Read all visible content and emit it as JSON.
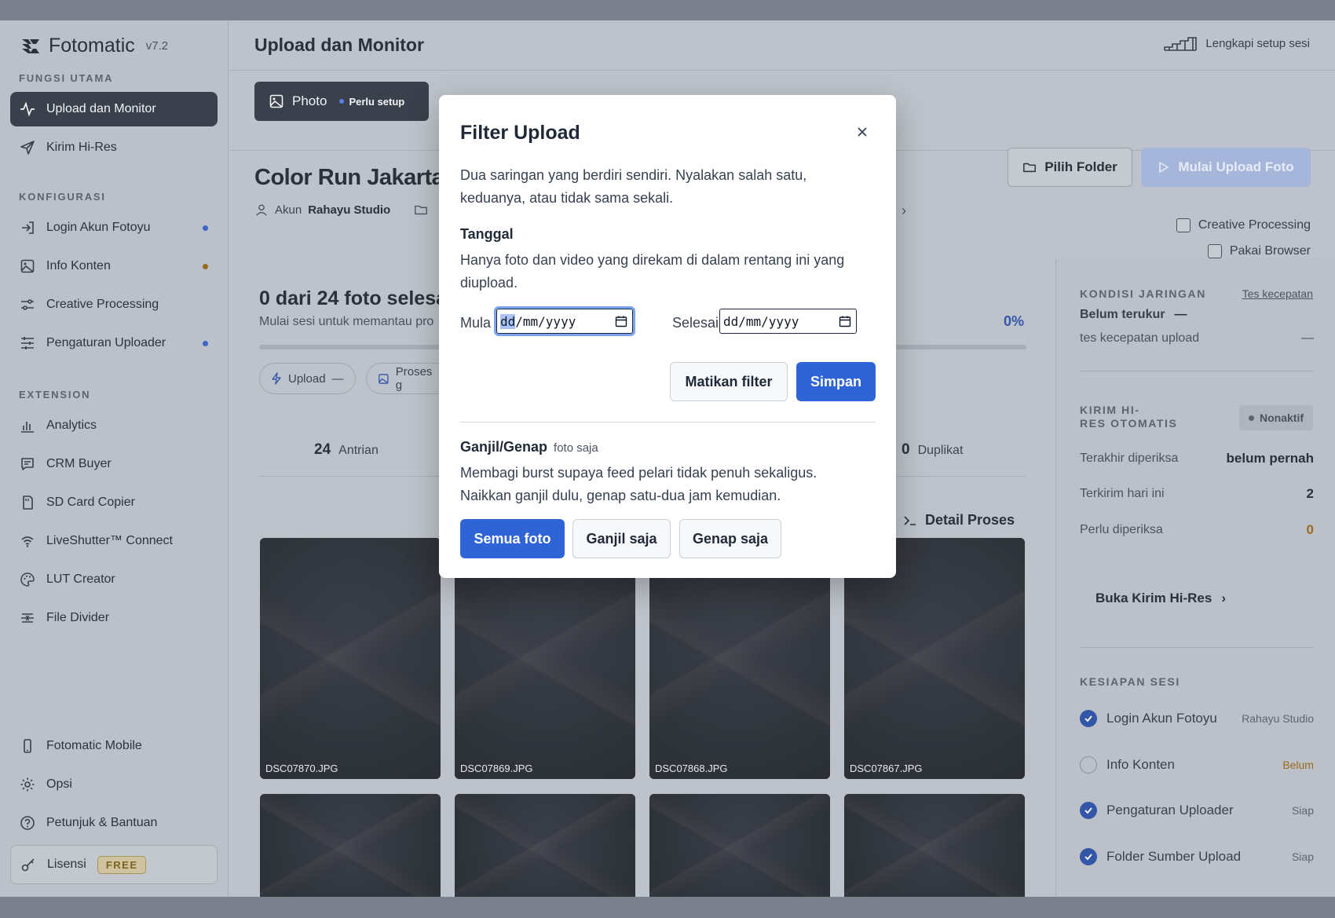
{
  "app": {
    "name": "Fotomatic",
    "version": "v7.2",
    "page_title": "Upload dan Monitor",
    "setup_link": "Lengkapi setup sesi"
  },
  "sidebar": {
    "section_main": "FUNGSI UTAMA",
    "section_config": "KONFIGURASI",
    "section_ext": "EXTENSION",
    "main_items": [
      {
        "label": "Upload dan Monitor",
        "icon": "activity-icon"
      },
      {
        "label": "Kirim Hi-Res",
        "icon": "send-icon"
      }
    ],
    "config_items": [
      {
        "label": "Login Akun Fotoyu",
        "icon": "login-icon",
        "dot": "blue"
      },
      {
        "label": "Info Konten",
        "icon": "image-icon",
        "dot": "amber"
      },
      {
        "label": "Creative Processing",
        "icon": "sliders-icon"
      },
      {
        "label": "Pengaturan Uploader",
        "icon": "settings-sliders-icon",
        "dot": "blue"
      }
    ],
    "ext_items": [
      {
        "label": "Analytics",
        "icon": "bar-chart-icon"
      },
      {
        "label": "CRM Buyer",
        "icon": "message-icon"
      },
      {
        "label": "SD Card Copier",
        "icon": "sd-card-icon"
      },
      {
        "label": "LiveShutter™ Connect",
        "icon": "wifi-icon"
      },
      {
        "label": "LUT Creator",
        "icon": "palette-icon"
      },
      {
        "label": "File Divider",
        "icon": "divider-icon"
      }
    ],
    "bottom_items": [
      {
        "label": "Fotomatic Mobile",
        "icon": "phone-icon"
      },
      {
        "label": "Opsi",
        "icon": "gear-icon"
      },
      {
        "label": "Petunjuk & Bantuan",
        "icon": "help-icon"
      }
    ],
    "license_label": "Lisensi",
    "license_badge": "FREE"
  },
  "tabs": {
    "photo_label": "Photo",
    "photo_badge": "Perlu setup"
  },
  "event": {
    "title": "Color Run Jakarta",
    "account_label": "Akun",
    "account_value": "Rahayu Studio"
  },
  "actions": {
    "pick_folder": "Pilih Folder",
    "start_upload": "Mulai Upload Foto",
    "creative_processing": "Creative Processing",
    "use_browser": "Pakai Browser"
  },
  "progress": {
    "title": "0 dari 24 foto selesa",
    "subtitle": "Mulai sesi untuk memantau pro",
    "percent_label": "0%",
    "fraction": 0,
    "pill_upload": "Upload",
    "pill_upload_value": "—",
    "pill_process": "Proses g",
    "queue_count": "24",
    "queue_label": "Antrian",
    "dup_count": "0",
    "dup_label": "Duplikat",
    "detail_label": "Detail Proses"
  },
  "thumbnails": [
    {
      "name": "DSC07870.JPG"
    },
    {
      "name": "DSC07869.JPG"
    },
    {
      "name": "DSC07868.JPG"
    },
    {
      "name": "DSC07867.JPG"
    },
    {
      "name": ""
    },
    {
      "name": ""
    },
    {
      "name": ""
    },
    {
      "name": ""
    }
  ],
  "right_panel": {
    "network_label": "KONDISI JARINGAN",
    "speed_test_link": "Tes kecepatan",
    "network_status": "Belum terukur",
    "network_status_dash": "—",
    "upload_speed_label": "tes kecepatan upload",
    "upload_speed_value": "—",
    "hires_label_1": "KIRIM HI-",
    "hires_label_2": "RES OTOMATIS",
    "hires_status": "Nonaktif",
    "last_checked_label": "Terakhir diperiksa",
    "last_checked_value": "belum pernah",
    "sent_today_label": "Terkirim hari ini",
    "sent_today_value": "2",
    "need_check_label": "Perlu diperiksa",
    "need_check_value": "0",
    "open_hires": "Buka Kirim Hi-Res",
    "readiness_label": "KESIAPAN SESI",
    "readiness": [
      {
        "label": "Login Akun Fotoyu",
        "status": "Rahayu Studio",
        "done": true
      },
      {
        "label": "Info Konten",
        "status": "Belum",
        "done": false
      },
      {
        "label": "Pengaturan Uploader",
        "status": "Siap",
        "done": true
      },
      {
        "label": "Folder Sumber Upload",
        "status": "Siap",
        "done": true
      }
    ]
  },
  "modal": {
    "title": "Filter Upload",
    "description": "Dua saringan yang berdiri sendiri. Nyalakan salah satu, keduanya, atau tidak sama sekali.",
    "date_heading": "Tanggal",
    "date_help": "Hanya foto dan video yang direkam di dalam rentang ini yang diupload.",
    "start_label": "Mula",
    "end_label": "Selesai",
    "start_value": "dd/mm/yyyy",
    "end_value": "dd/mm/yyyy",
    "disable_filter": "Matikan filter",
    "save": "Simpan",
    "oddeven_heading": "Ganjil/Genap",
    "oddeven_tag": "foto saja",
    "oddeven_help": "Membagi burst supaya feed pelari tidak penuh sekaligus. Naikkan ganjil dulu, genap satu-dua jam kemudian.",
    "opt_all": "Semua foto",
    "opt_odd": "Ganjil saja",
    "opt_even": "Genap saja"
  }
}
